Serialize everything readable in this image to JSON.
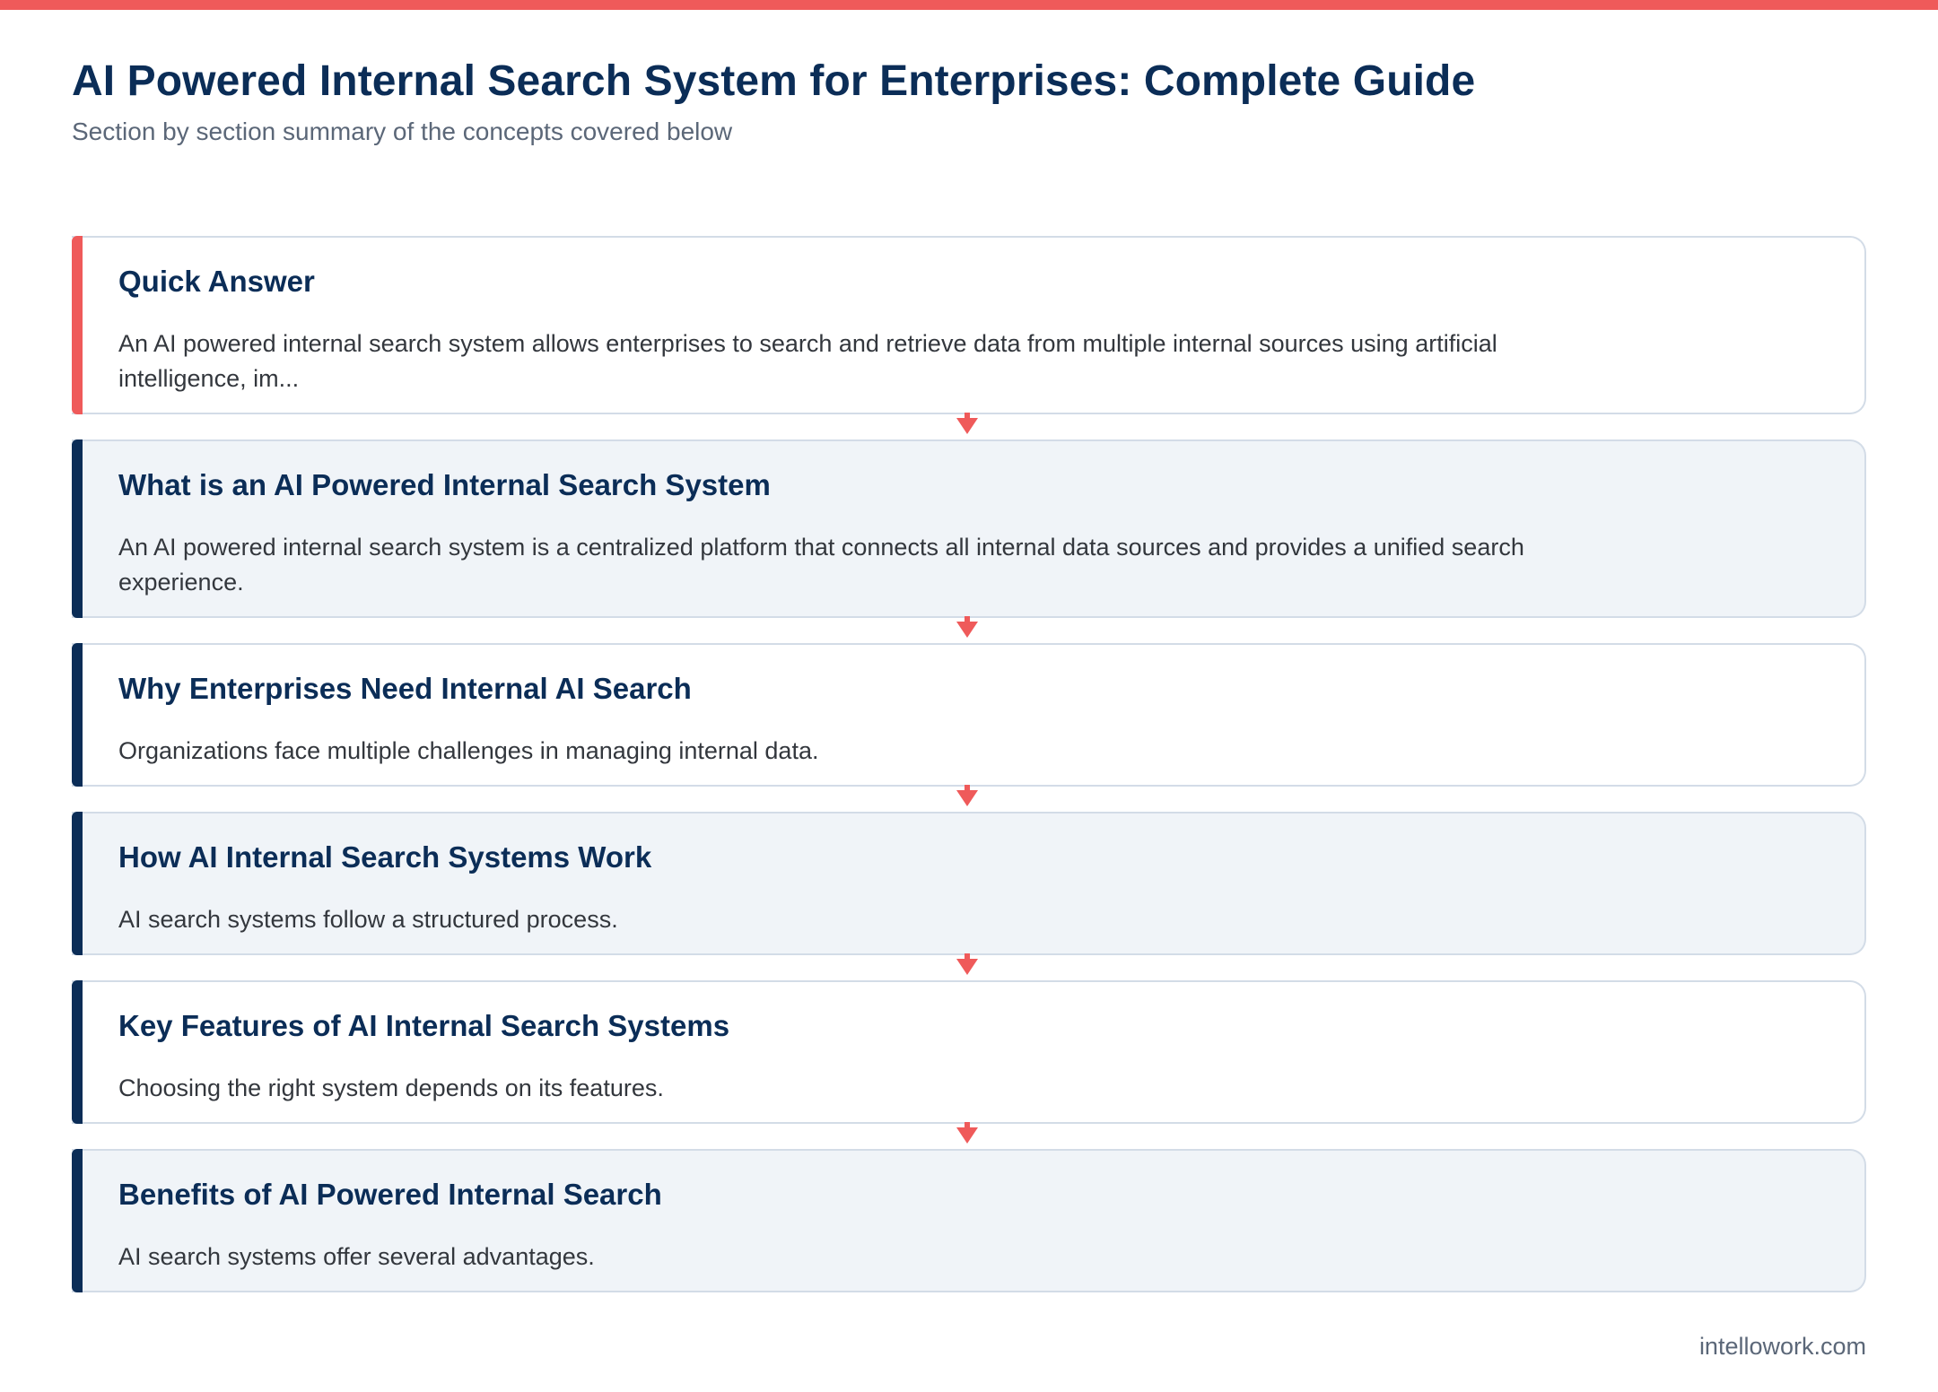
{
  "header": {
    "title": "AI Powered Internal Search System for Enterprises: Complete Guide",
    "subtitle": "Section by section summary of the concepts covered below"
  },
  "colors": {
    "accent_highlight": "#ef5a5a",
    "accent_default": "#0b2d57",
    "card_tint": "#f0f4f8"
  },
  "sections": [
    {
      "title": "Quick Answer",
      "text": "An AI powered internal search system allows enterprises to search and retrieve data from multiple internal sources using artificial intelligence, im..."
    },
    {
      "title": "What is an AI Powered Internal Search System",
      "text": "An AI powered internal search system is a centralized platform that connects all internal data sources and provides a unified search experience."
    },
    {
      "title": "Why Enterprises Need Internal AI Search",
      "text": "Organizations face multiple challenges in managing internal data."
    },
    {
      "title": "How AI Internal Search Systems Work",
      "text": "AI search systems follow a structured process."
    },
    {
      "title": "Key Features of AI Internal Search Systems",
      "text": "Choosing the right system depends on its features."
    },
    {
      "title": "Benefits of AI Powered Internal Search",
      "text": "AI search systems offer several advantages."
    }
  ],
  "footer": {
    "site": "intellowork.com"
  }
}
